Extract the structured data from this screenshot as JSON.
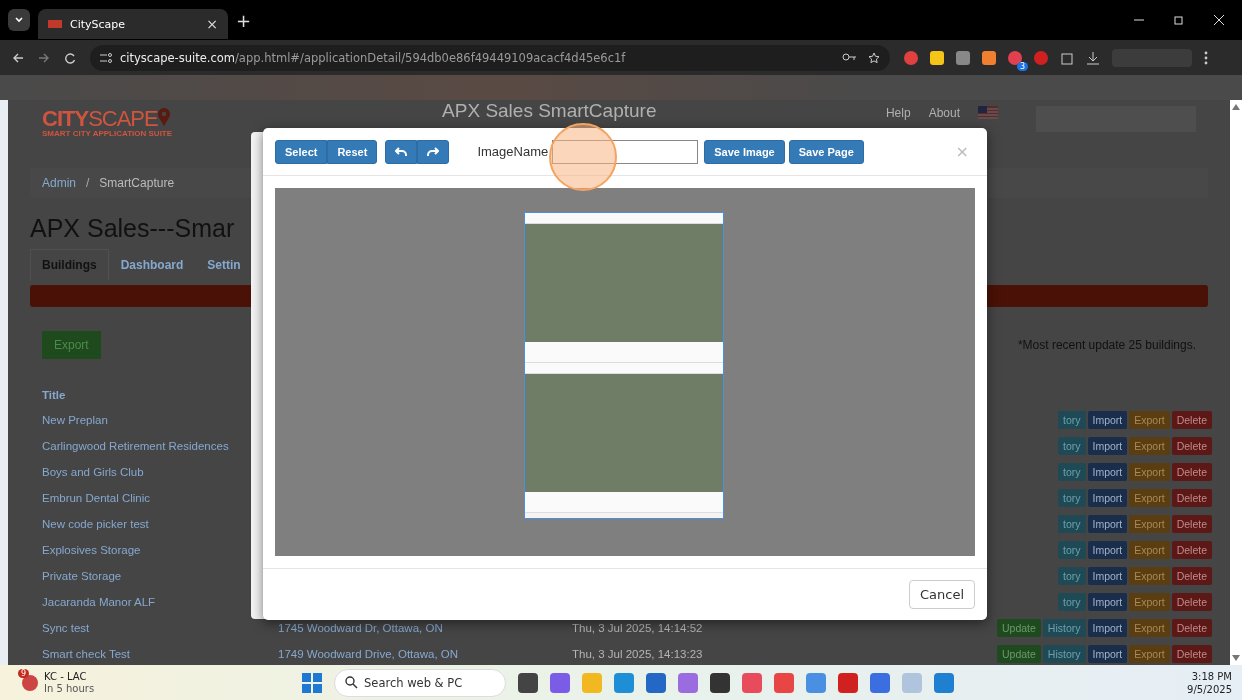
{
  "browser": {
    "tab": {
      "title": "CityScape",
      "close": "×"
    },
    "new_tab": "+",
    "url_domain": "cityscape-suite.com",
    "url_path": "/app.html#/applicationDetail/594db0e86f49449109acacf4d45e6c1f",
    "extension_badge": "3"
  },
  "page": {
    "logo": {
      "city": "CITY",
      "scape": "SCAPE",
      "tagline": "SMART CITY APPLICATION SUITE"
    },
    "app_title": "APX Sales SmartCapture",
    "nav": [
      "Help",
      "About"
    ],
    "breadcrumb": [
      "Admin",
      "SmartCapture"
    ],
    "breadcrumb_separator": "/",
    "heading": "APX Sales---Smar",
    "tabs": [
      {
        "label": "Buildings",
        "selected": true
      },
      {
        "label": "Dashboard",
        "selected": false
      },
      {
        "label": "Settin",
        "selected": false
      }
    ],
    "export_button": "Export",
    "update_note": "*Most recent update 25 buildings.",
    "table": {
      "columns": [
        "Title"
      ],
      "rows": [
        {
          "title": "New Preplan",
          "actions": [
            {
              "kind": "history",
              "label": "tory"
            },
            {
              "kind": "import",
              "label": "Import"
            },
            {
              "kind": "export",
              "label": "Export"
            },
            {
              "kind": "delete",
              "label": "Delete"
            }
          ]
        },
        {
          "title": "Carlingwood Retirement Residences",
          "actions": [
            {
              "kind": "history",
              "label": "tory"
            },
            {
              "kind": "import",
              "label": "Import"
            },
            {
              "kind": "export",
              "label": "Export"
            },
            {
              "kind": "delete",
              "label": "Delete"
            }
          ]
        },
        {
          "title": "Boys and Girls Club",
          "actions": [
            {
              "kind": "history",
              "label": "tory"
            },
            {
              "kind": "import",
              "label": "Import"
            },
            {
              "kind": "export",
              "label": "Export"
            },
            {
              "kind": "delete",
              "label": "Delete"
            }
          ]
        },
        {
          "title": "Embrun Dental Clinic",
          "actions": [
            {
              "kind": "history",
              "label": "tory"
            },
            {
              "kind": "import",
              "label": "Import"
            },
            {
              "kind": "export",
              "label": "Export"
            },
            {
              "kind": "delete",
              "label": "Delete"
            }
          ]
        },
        {
          "title": "New code picker test",
          "actions": [
            {
              "kind": "history",
              "label": "tory"
            },
            {
              "kind": "import",
              "label": "Import"
            },
            {
              "kind": "export",
              "label": "Export"
            },
            {
              "kind": "delete",
              "label": "Delete"
            }
          ]
        },
        {
          "title": "Explosives Storage",
          "actions": [
            {
              "kind": "history",
              "label": "tory"
            },
            {
              "kind": "import",
              "label": "Import"
            },
            {
              "kind": "export",
              "label": "Export"
            },
            {
              "kind": "delete",
              "label": "Delete"
            }
          ]
        },
        {
          "title": "Private Storage",
          "actions": [
            {
              "kind": "history",
              "label": "tory"
            },
            {
              "kind": "import",
              "label": "Import"
            },
            {
              "kind": "export",
              "label": "Export"
            },
            {
              "kind": "delete",
              "label": "Delete"
            }
          ]
        },
        {
          "title": "Jacaranda Manor ALF",
          "actions": [
            {
              "kind": "history",
              "label": "tory"
            },
            {
              "kind": "import",
              "label": "Import"
            },
            {
              "kind": "export",
              "label": "Export"
            },
            {
              "kind": "delete",
              "label": "Delete"
            }
          ]
        },
        {
          "title": "Sync test",
          "address": "1745 Woodward Dr, Ottawa, ON",
          "date": "Thu, 3 Jul 2025, 14:14:52",
          "actions": [
            {
              "kind": "update",
              "label": "Update"
            },
            {
              "kind": "history",
              "label": "History"
            },
            {
              "kind": "import",
              "label": "Import"
            },
            {
              "kind": "export",
              "label": "Export"
            },
            {
              "kind": "delete",
              "label": "Delete"
            }
          ]
        },
        {
          "title": "Smart check Test",
          "address": "1749 Woodward Drive, Ottawa, ON",
          "date": "Thu, 3 Jul 2025, 14:13:23",
          "actions": [
            {
              "kind": "update",
              "label": "Update"
            },
            {
              "kind": "history",
              "label": "History"
            },
            {
              "kind": "import",
              "label": "Import"
            },
            {
              "kind": "export",
              "label": "Export"
            },
            {
              "kind": "delete",
              "label": "Delete"
            }
          ]
        }
      ]
    }
  },
  "modal": {
    "select_button": "Select",
    "reset_button": "Reset",
    "image_name_label": "ImageName",
    "save_image_button": "Save Image",
    "save_page_button": "Save Page",
    "close": "×",
    "cancel_button": "Cancel"
  },
  "taskbar": {
    "weather": {
      "badge": "9",
      "title": "KC - LAC",
      "subtitle": "In 5 hours"
    },
    "search_placeholder": "Search web & PC",
    "time": "3:18 PM",
    "date": "9/5/2025"
  }
}
